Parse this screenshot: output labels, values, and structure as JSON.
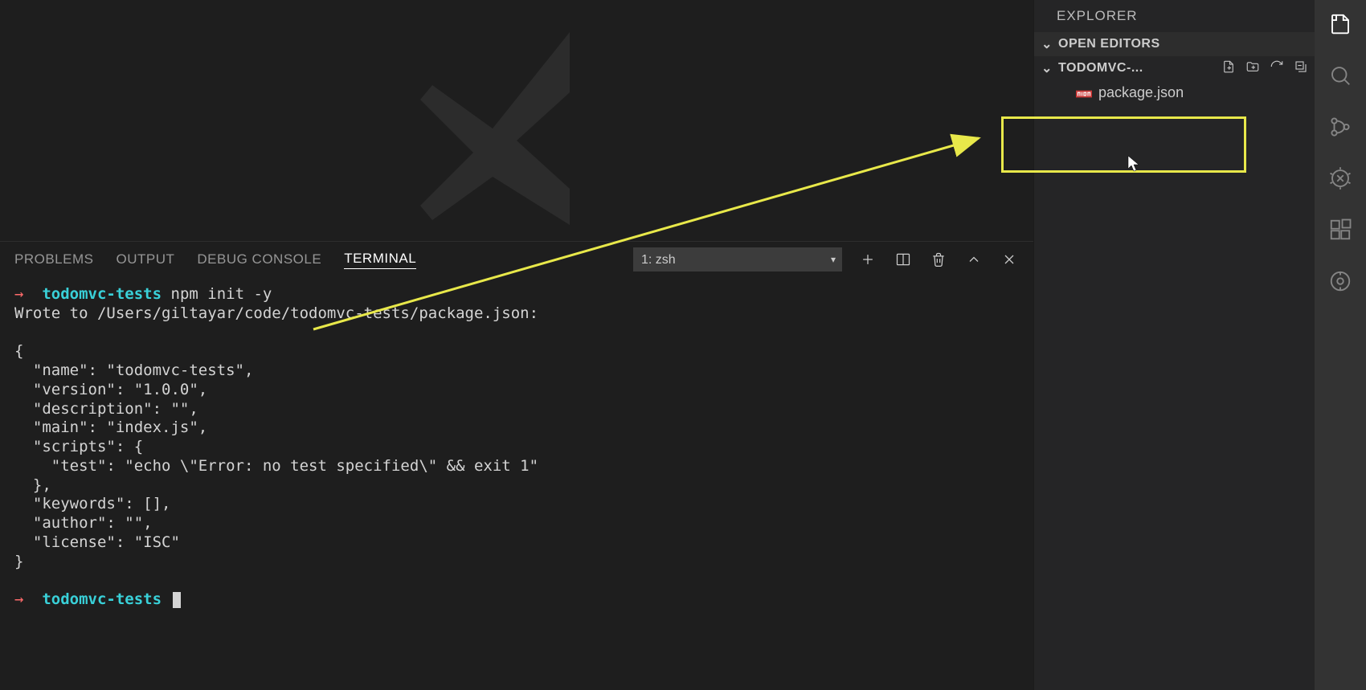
{
  "panel": {
    "tabs": {
      "problems": "PROBLEMS",
      "output": "OUTPUT",
      "debug_console": "DEBUG CONSOLE",
      "terminal": "TERMINAL"
    },
    "shell_select": "1: zsh"
  },
  "terminal": {
    "prompt_arrow": "→",
    "dir": "todomvc-tests",
    "command": "npm init -y",
    "lines": [
      "Wrote to /Users/giltayar/code/todomvc-tests/package.json:",
      "",
      "{",
      "  \"name\": \"todomvc-tests\",",
      "  \"version\": \"1.0.0\",",
      "  \"description\": \"\",",
      "  \"main\": \"index.js\",",
      "  \"scripts\": {",
      "    \"test\": \"echo \\\"Error: no test specified\\\" && exit 1\"",
      "  },",
      "  \"keywords\": [],",
      "  \"author\": \"\",",
      "  \"license\": \"ISC\"",
      "}",
      ""
    ]
  },
  "explorer": {
    "title": "EXPLORER",
    "open_editors": "OPEN EDITORS",
    "project_name": "TODOMVC-...",
    "files": [
      {
        "name": "package.json"
      }
    ]
  },
  "annotation": {
    "arrow_color": "#e8e84a"
  }
}
